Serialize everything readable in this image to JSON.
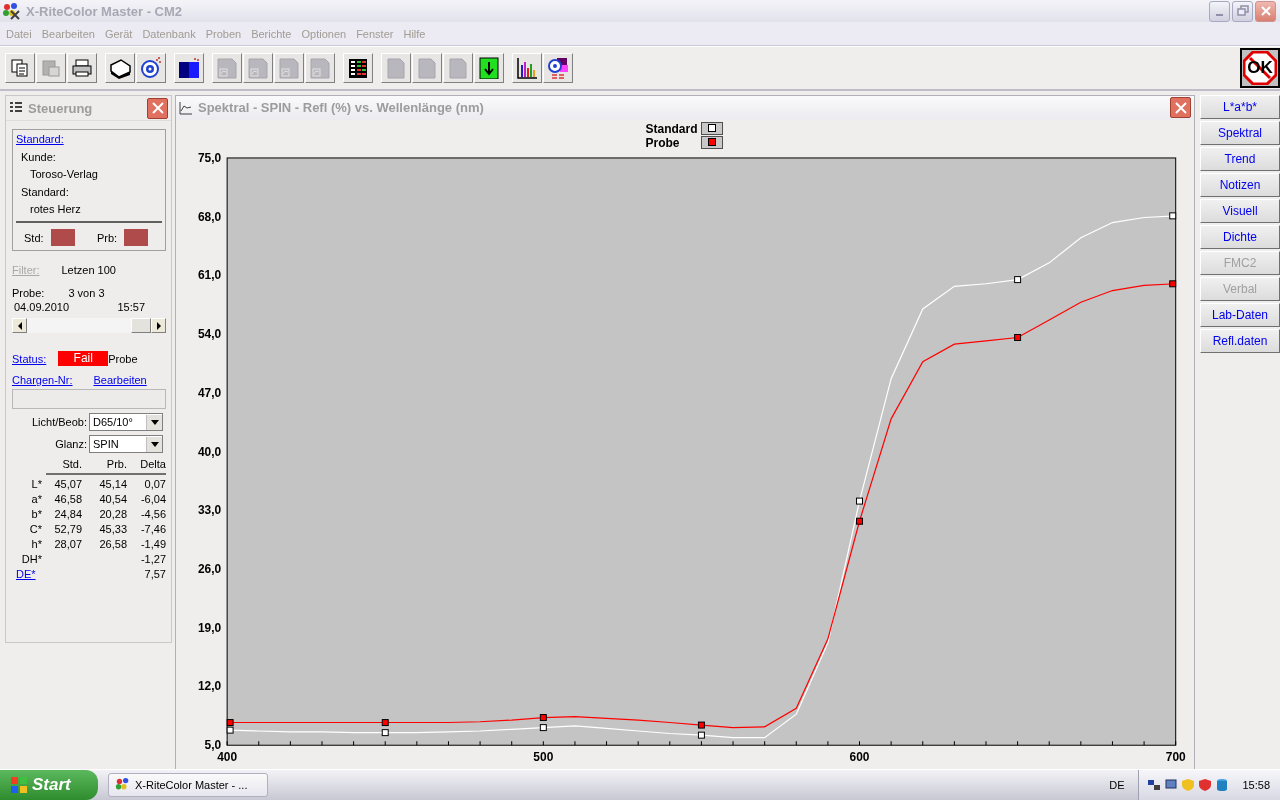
{
  "window": {
    "title": "X-RiteColor Master - CM2"
  },
  "menu": [
    "Datei",
    "Bearbeiten",
    "Gerät",
    "Datenbank",
    "Proben",
    "Berichte",
    "Optionen",
    "Fenster",
    "Hilfe"
  ],
  "toolbar": [
    {
      "buttons": [
        {
          "kind": "copy",
          "disabled": false
        },
        {
          "kind": "paste",
          "disabled": true
        },
        {
          "kind": "print",
          "disabled": false
        }
      ]
    },
    {
      "buttons": [
        {
          "kind": "instrument",
          "disabled": false
        },
        {
          "kind": "target",
          "disabled": false
        }
      ]
    },
    {
      "buttons": [
        {
          "kind": "color-square",
          "disabled": false
        }
      ]
    },
    {
      "buttons": [
        {
          "kind": "chart-doc",
          "disabled": true
        },
        {
          "kind": "chart-doc",
          "disabled": true
        },
        {
          "kind": "chart-doc",
          "disabled": true
        },
        {
          "kind": "chart-doc",
          "disabled": true
        }
      ]
    },
    {
      "buttons": [
        {
          "kind": "table",
          "disabled": false
        }
      ]
    },
    {
      "buttons": [
        {
          "kind": "doc",
          "disabled": true
        },
        {
          "kind": "doc",
          "disabled": true
        },
        {
          "kind": "doc",
          "disabled": true
        },
        {
          "kind": "download",
          "disabled": false
        }
      ]
    },
    {
      "buttons": [
        {
          "kind": "bar-chart",
          "disabled": false
        },
        {
          "kind": "color-target",
          "disabled": false
        }
      ]
    }
  ],
  "status_sign": "OK",
  "control_panel": {
    "title": "Steuerung",
    "standard_box": {
      "link": "Standard:",
      "lines": [
        {
          "label": "Kunde:",
          "value": "Toroso-Verlag"
        },
        {
          "label": "Standard:",
          "value": "rotes Herz"
        }
      ],
      "swatches": [
        {
          "label": "Std:",
          "color": "#b04b4b"
        },
        {
          "label": "Prb:",
          "color": "#b04b4b"
        }
      ]
    },
    "filter": {
      "label": "Filter:",
      "disabled": true,
      "value": "Letzen 100"
    },
    "sample": {
      "label": "Probe:",
      "value": "3 von 3",
      "date": "04.09.2010",
      "time": "15:57"
    },
    "status": {
      "label": "Status:",
      "value": "Fail",
      "color": "#ff0000",
      "suffix": "Probe"
    },
    "batch": {
      "label": "Chargen-Nr:",
      "edit_link": "Bearbeiten",
      "disabled": true
    },
    "selects": [
      {
        "label": "Licht/Beob:",
        "value": "D65/10°"
      },
      {
        "label": "Glanz:",
        "value": "SPIN"
      }
    ],
    "table": {
      "columns": [
        "Std.",
        "Prb.",
        "Delta"
      ],
      "rows": [
        {
          "kind": "plain",
          "label": "L*",
          "cells": [
            "45,07",
            "45,14",
            "0,07"
          ]
        },
        {
          "kind": "plain",
          "label": "a*",
          "cells": [
            "46,58",
            "40,54",
            "-6,04"
          ]
        },
        {
          "kind": "plain",
          "label": "b*",
          "cells": [
            "24,84",
            "20,28",
            "-4,56"
          ]
        },
        {
          "kind": "plain",
          "label": "C*",
          "cells": [
            "52,79",
            "45,33",
            "-7,46"
          ]
        },
        {
          "kind": "plain",
          "label": "h*",
          "cells": [
            "28,07",
            "26,58",
            "-1,49"
          ]
        },
        {
          "kind": "plain",
          "label": "DH*",
          "cells": [
            "",
            "",
            "-1,27"
          ]
        },
        {
          "kind": "link",
          "label": "DE*",
          "cells": [
            "",
            "",
            "7,57"
          ]
        }
      ]
    }
  },
  "chart_window": {
    "title": "Spektral - SPIN - Refl (%) vs. Wellenlänge (nm)",
    "chart_data": {
      "type": "line",
      "x": [
        400,
        410,
        420,
        430,
        440,
        450,
        460,
        470,
        480,
        490,
        500,
        510,
        520,
        530,
        540,
        550,
        560,
        570,
        580,
        590,
        600,
        610,
        620,
        630,
        640,
        650,
        660,
        670,
        680,
        690,
        700
      ],
      "xlim": [
        400,
        700
      ],
      "ylim": [
        5,
        75
      ],
      "xticks": [
        400,
        500,
        600,
        700
      ],
      "yticks": [
        {
          "value": 5,
          "label": "5,0"
        },
        {
          "value": 12,
          "label": "12,0"
        },
        {
          "value": 19,
          "label": "19,0"
        },
        {
          "value": 26,
          "label": "26,0"
        },
        {
          "value": 33,
          "label": "33,0"
        },
        {
          "value": 40,
          "label": "40,0"
        },
        {
          "value": 47,
          "label": "47,0"
        },
        {
          "value": 54,
          "label": "54,0"
        },
        {
          "value": 61,
          "label": "61,0"
        },
        {
          "value": 68,
          "label": "68,0"
        },
        {
          "value": 75,
          "label": "75,0"
        }
      ],
      "series": [
        {
          "name": "Standard",
          "color": "#ffffff",
          "values": [
            6.8,
            6.7,
            6.6,
            6.6,
            6.5,
            6.5,
            6.5,
            6.6,
            6.7,
            6.9,
            7.1,
            7.3,
            7.0,
            6.7,
            6.4,
            6.2,
            5.9,
            5.9,
            8.7,
            17.2,
            34.1,
            48.7,
            57.0,
            59.7,
            60.0,
            60.5,
            62.5,
            65.5,
            67.3,
            67.9,
            68.1
          ]
        },
        {
          "name": "Probe",
          "color": "#ff0000",
          "values": [
            7.7,
            7.7,
            7.7,
            7.7,
            7.7,
            7.7,
            7.7,
            7.7,
            7.8,
            8.0,
            8.3,
            8.4,
            8.2,
            8.0,
            7.7,
            7.4,
            7.1,
            7.2,
            9.4,
            17.7,
            31.7,
            43.9,
            50.7,
            52.8,
            53.2,
            53.6,
            55.7,
            57.8,
            59.2,
            59.8,
            60.0
          ]
        }
      ]
    }
  },
  "view_buttons": [
    {
      "label": "L*a*b*",
      "disabled": false
    },
    {
      "label": "Spektral",
      "disabled": false
    },
    {
      "label": "Trend",
      "disabled": false
    },
    {
      "label": "Notizen",
      "disabled": false
    },
    {
      "label": "Visuell",
      "disabled": false
    },
    {
      "label": "Dichte",
      "disabled": false
    },
    {
      "label": "FMC2",
      "disabled": true
    },
    {
      "label": "Verbal",
      "disabled": true
    },
    {
      "label": "Lab-Daten",
      "disabled": false
    },
    {
      "label": "Refl.daten",
      "disabled": false
    }
  ],
  "taskbar": {
    "start": "Start",
    "task": "X-RiteColor Master - ...",
    "language": "DE",
    "clock": "15:58"
  }
}
